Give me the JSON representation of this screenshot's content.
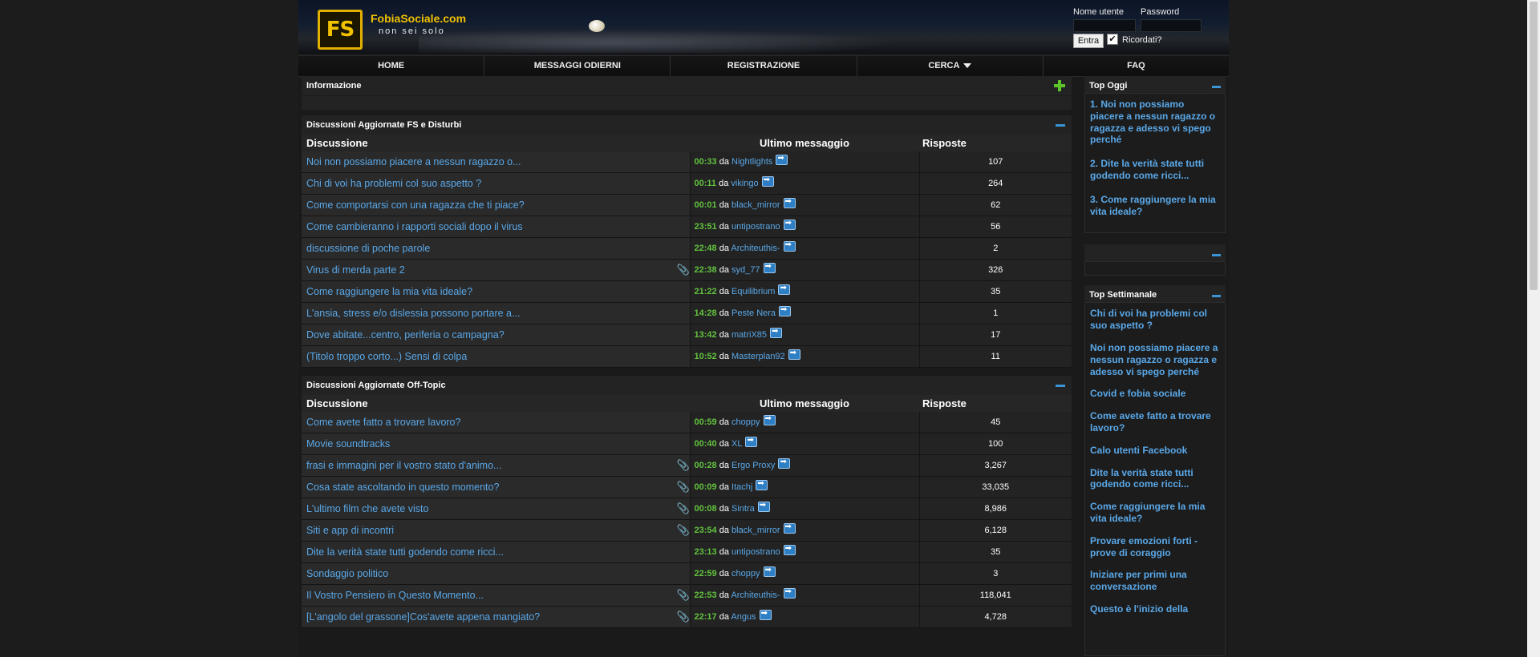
{
  "header": {
    "logo_letters": "FS",
    "site_name": "FobiaSociale.com",
    "tagline": "non sei solo"
  },
  "login": {
    "username_label": "Nome utente",
    "password_label": "Password",
    "submit_label": "Entra",
    "remember_label": "Ricordati?",
    "remember_checked": true
  },
  "nav": {
    "items": [
      "HOME",
      "MESSAGGI ODIERNI",
      "REGISTRAZIONE",
      "CERCA",
      "FAQ"
    ]
  },
  "info_block": {
    "title": "Informazione"
  },
  "fs_block": {
    "title": "Discussioni Aggiornate FS e Disturbi",
    "col_topic": "Discussione",
    "col_last": "Ultimo messaggio",
    "col_replies": "Risposte",
    "da": "da",
    "rows": [
      {
        "topic": "Noi non possiamo piacere a nessun ragazzo o...",
        "time": "00:33",
        "user": "Nightlights",
        "replies": "107",
        "attach": false
      },
      {
        "topic": "Chi di voi ha problemi col suo aspetto ?",
        "time": "00:11",
        "user": "vikingo",
        "replies": "264",
        "attach": false
      },
      {
        "topic": "Come comportarsi con una ragazza che ti piace?",
        "time": "00:01",
        "user": "black_mirror",
        "replies": "62",
        "attach": false
      },
      {
        "topic": "Come cambieranno i rapporti sociali dopo il virus",
        "time": "23:51",
        "user": "untipostrano",
        "replies": "56",
        "attach": false
      },
      {
        "topic": "discussione di poche parole",
        "time": "22:48",
        "user": "Architeuthis-",
        "replies": "2",
        "attach": false
      },
      {
        "topic": "Virus di merda parte 2",
        "time": "22:38",
        "user": "syd_77",
        "replies": "326",
        "attach": true
      },
      {
        "topic": "Come raggiungere la mia vita ideale?",
        "time": "21:22",
        "user": "Equilibrium",
        "replies": "35",
        "attach": false
      },
      {
        "topic": "L'ansia, stress e/o dislessia possono portare a...",
        "time": "14:28",
        "user": "Peste Nera",
        "replies": "1",
        "attach": false
      },
      {
        "topic": "Dove abitate...centro, periferia o campagna?",
        "time": "13:42",
        "user": "matriX85",
        "replies": "17",
        "attach": false
      },
      {
        "topic": "(Titolo troppo corto...) Sensi di colpa",
        "time": "10:52",
        "user": "Masterplan92",
        "replies": "11",
        "attach": false
      }
    ]
  },
  "ot_block": {
    "title": "Discussioni Aggiornate Off-Topic",
    "col_topic": "Discussione",
    "col_last": "Ultimo messaggio",
    "col_replies": "Risposte",
    "da": "da",
    "rows": [
      {
        "topic": "Come avete fatto a trovare lavoro?",
        "time": "00:59",
        "user": "choppy",
        "replies": "45",
        "attach": false
      },
      {
        "topic": "Movie soundtracks",
        "time": "00:40",
        "user": "XL",
        "replies": "100",
        "attach": false
      },
      {
        "topic": "frasi e immagini per il vostro stato d'animo...",
        "time": "00:28",
        "user": "Ergo Proxy",
        "replies": "3,267",
        "attach": true
      },
      {
        "topic": "Cosa state ascoltando in questo momento?",
        "time": "00:09",
        "user": "Itachj",
        "replies": "33,035",
        "attach": true
      },
      {
        "topic": "L'ultimo film che avete visto",
        "time": "00:08",
        "user": "Sintra",
        "replies": "8,986",
        "attach": true
      },
      {
        "topic": "Siti e app di incontri",
        "time": "23:54",
        "user": "black_mirror",
        "replies": "6,128",
        "attach": true
      },
      {
        "topic": "Dite la verità state tutti godendo come ricci...",
        "time": "23:13",
        "user": "untipostrano",
        "replies": "35",
        "attach": false
      },
      {
        "topic": "Sondaggio politico",
        "time": "22:59",
        "user": "choppy",
        "replies": "3",
        "attach": false
      },
      {
        "topic": "Il Vostro Pensiero in Questo Momento...",
        "time": "22:53",
        "user": "Architeuthis-",
        "replies": "118,041",
        "attach": true
      },
      {
        "topic": "[L'angolo del grassone]Cos'avete appena mangiato?",
        "time": "22:17",
        "user": "Angus",
        "replies": "4,728",
        "attach": true
      }
    ]
  },
  "sidebar": {
    "top_today": {
      "title": "Top Oggi",
      "items": [
        "1. Noi non possiamo piacere a nessun ragazzo o ragazza e adesso vi spego perché",
        "2. Dite la verità state tutti godendo come ricci...",
        "3. Come raggiungere la mia vita ideale?"
      ]
    },
    "top_week": {
      "title": "Top Settimanale",
      "items": [
        "Chi di voi ha problemi col suo aspetto ?",
        "Noi non possiamo piacere a nessun ragazzo o ragazza e adesso vi spego perché",
        "Covid e fobia sociale",
        "Come avete fatto a trovare lavoro?",
        "Calo utenti Facebook",
        "Dite la verità state tutti godendo come ricci...",
        "Come raggiungere la mia vita ideale?",
        "Provare emozioni forti - prove di coraggio",
        "Iniziare per primi una conversazione",
        "Questo è l'inizio della"
      ]
    }
  }
}
